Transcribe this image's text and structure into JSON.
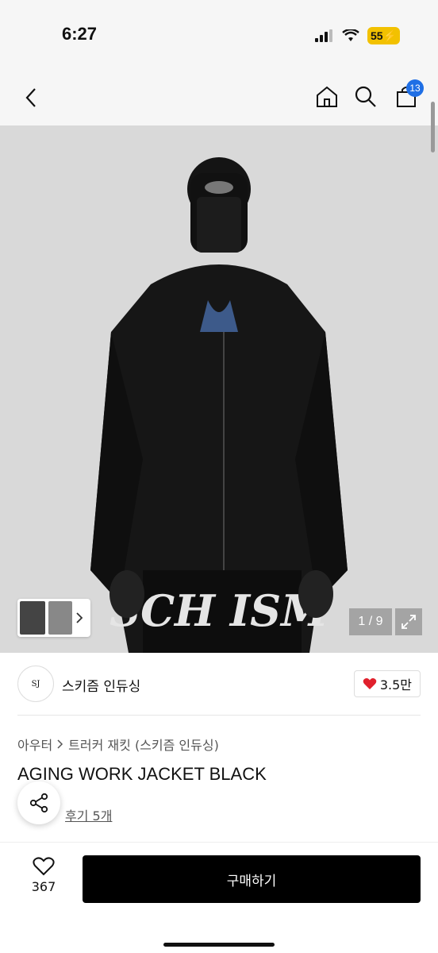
{
  "status": {
    "time": "6:27",
    "battery": "55"
  },
  "header": {
    "cart_count": "13"
  },
  "gallery": {
    "pager": "1 / 9"
  },
  "hero_print": "SCH ISM",
  "brand": {
    "logo_text": "SJ",
    "name": "스키즘 인듀싱",
    "likes": "3.5만"
  },
  "breadcrumb": {
    "category": "아우터",
    "subcategory": "트러커 재킷 (스키즘 인듀싱)"
  },
  "product": {
    "title": "AGING WORK JACKET BLACK",
    "review_link": "후기 5개"
  },
  "bottom": {
    "wish_count": "367",
    "buy_label": "구매하기"
  },
  "colors": {
    "accent": "#1f6fe5",
    "heart": "#e0202c",
    "battery": "#f2c100"
  }
}
